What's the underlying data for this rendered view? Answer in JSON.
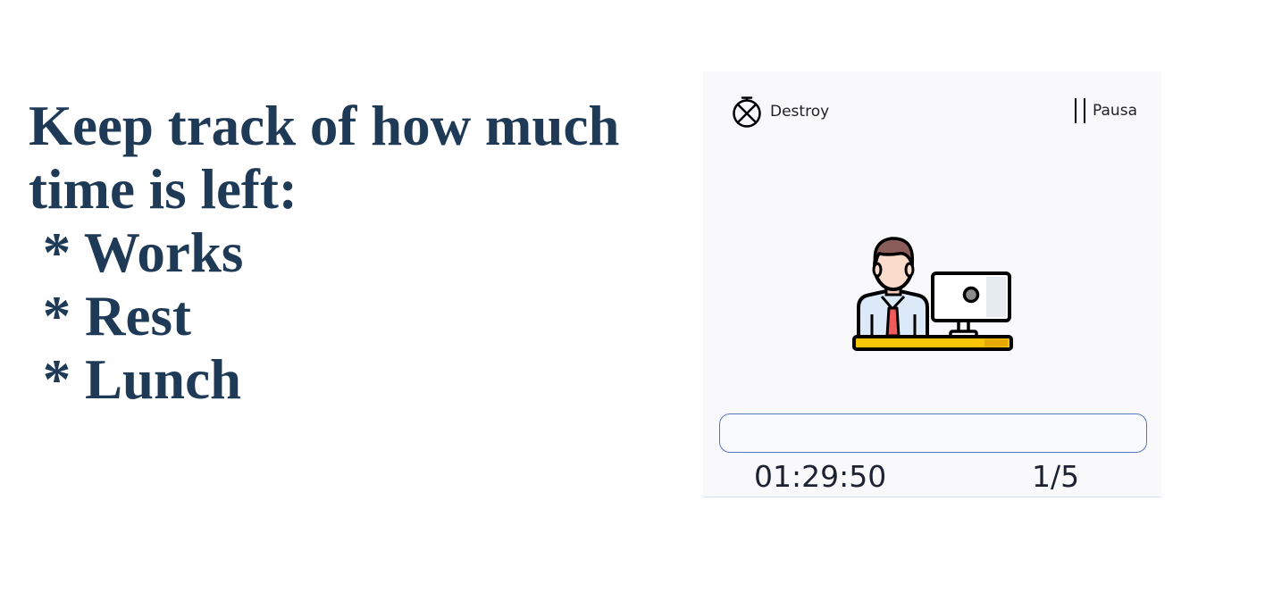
{
  "headline": {
    "lines": [
      "Keep track of how much",
      "time is left:",
      " * Works",
      " * Rest",
      " * Lunch"
    ]
  },
  "widget": {
    "destroy_label": "Destroy",
    "destroy_icon": "timer-cancel-icon",
    "pause_label": "Pausa",
    "pause_icon": "pause-icon",
    "illustration_icon": "office-worker-icon",
    "progress_value": 0,
    "timer_text": "01:29:50",
    "session_counter": "1/5"
  },
  "colors": {
    "headline": "#1f3a56",
    "panel_background": "#f9f9fb",
    "progress_border": "#5877c3",
    "desk": "#f7c600",
    "tie": "#ef5a5a",
    "shirt": "#dce9f8"
  }
}
